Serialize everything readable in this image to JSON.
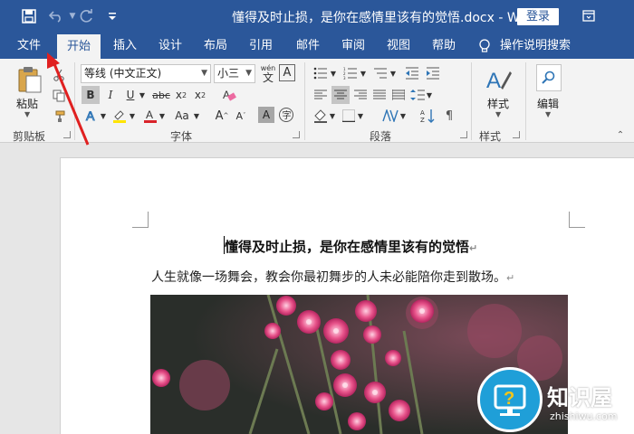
{
  "window": {
    "title": "懂得及时止损，是你在感情里该有的觉悟.docx  -  Word",
    "login_label": "登录"
  },
  "tabs": [
    {
      "label": "文件"
    },
    {
      "label": "开始"
    },
    {
      "label": "插入"
    },
    {
      "label": "设计"
    },
    {
      "label": "布局"
    },
    {
      "label": "引用"
    },
    {
      "label": "邮件"
    },
    {
      "label": "审阅"
    },
    {
      "label": "视图"
    },
    {
      "label": "帮助"
    }
  ],
  "active_tab": "开始",
  "tell_me": "操作说明搜索",
  "ribbon": {
    "clipboard": {
      "paste_label": "粘贴",
      "group_label": "剪贴板"
    },
    "font": {
      "font_name": "等线 (中文正文)",
      "font_size": "小三",
      "wen_label": "wén",
      "case_label": "Aa",
      "group_label": "字体"
    },
    "paragraph": {
      "group_label": "段落"
    },
    "styles": {
      "styles_label": "样式",
      "group_label": "样式"
    },
    "editing": {
      "editing_label": "编辑"
    }
  },
  "document": {
    "title": "懂得及时止损，是你在感情里该有的觉悟",
    "body": "人生就像一场舞会，教会你最初舞步的人未必能陪你走到散场。",
    "para_mark": "↵"
  },
  "watermark": {
    "brand": "知识屋",
    "url": "zhishiwu.com"
  },
  "colors": {
    "accent": "#2b579a",
    "font_red": "#d9232a",
    "highlight_yellow": "#ffe400"
  }
}
